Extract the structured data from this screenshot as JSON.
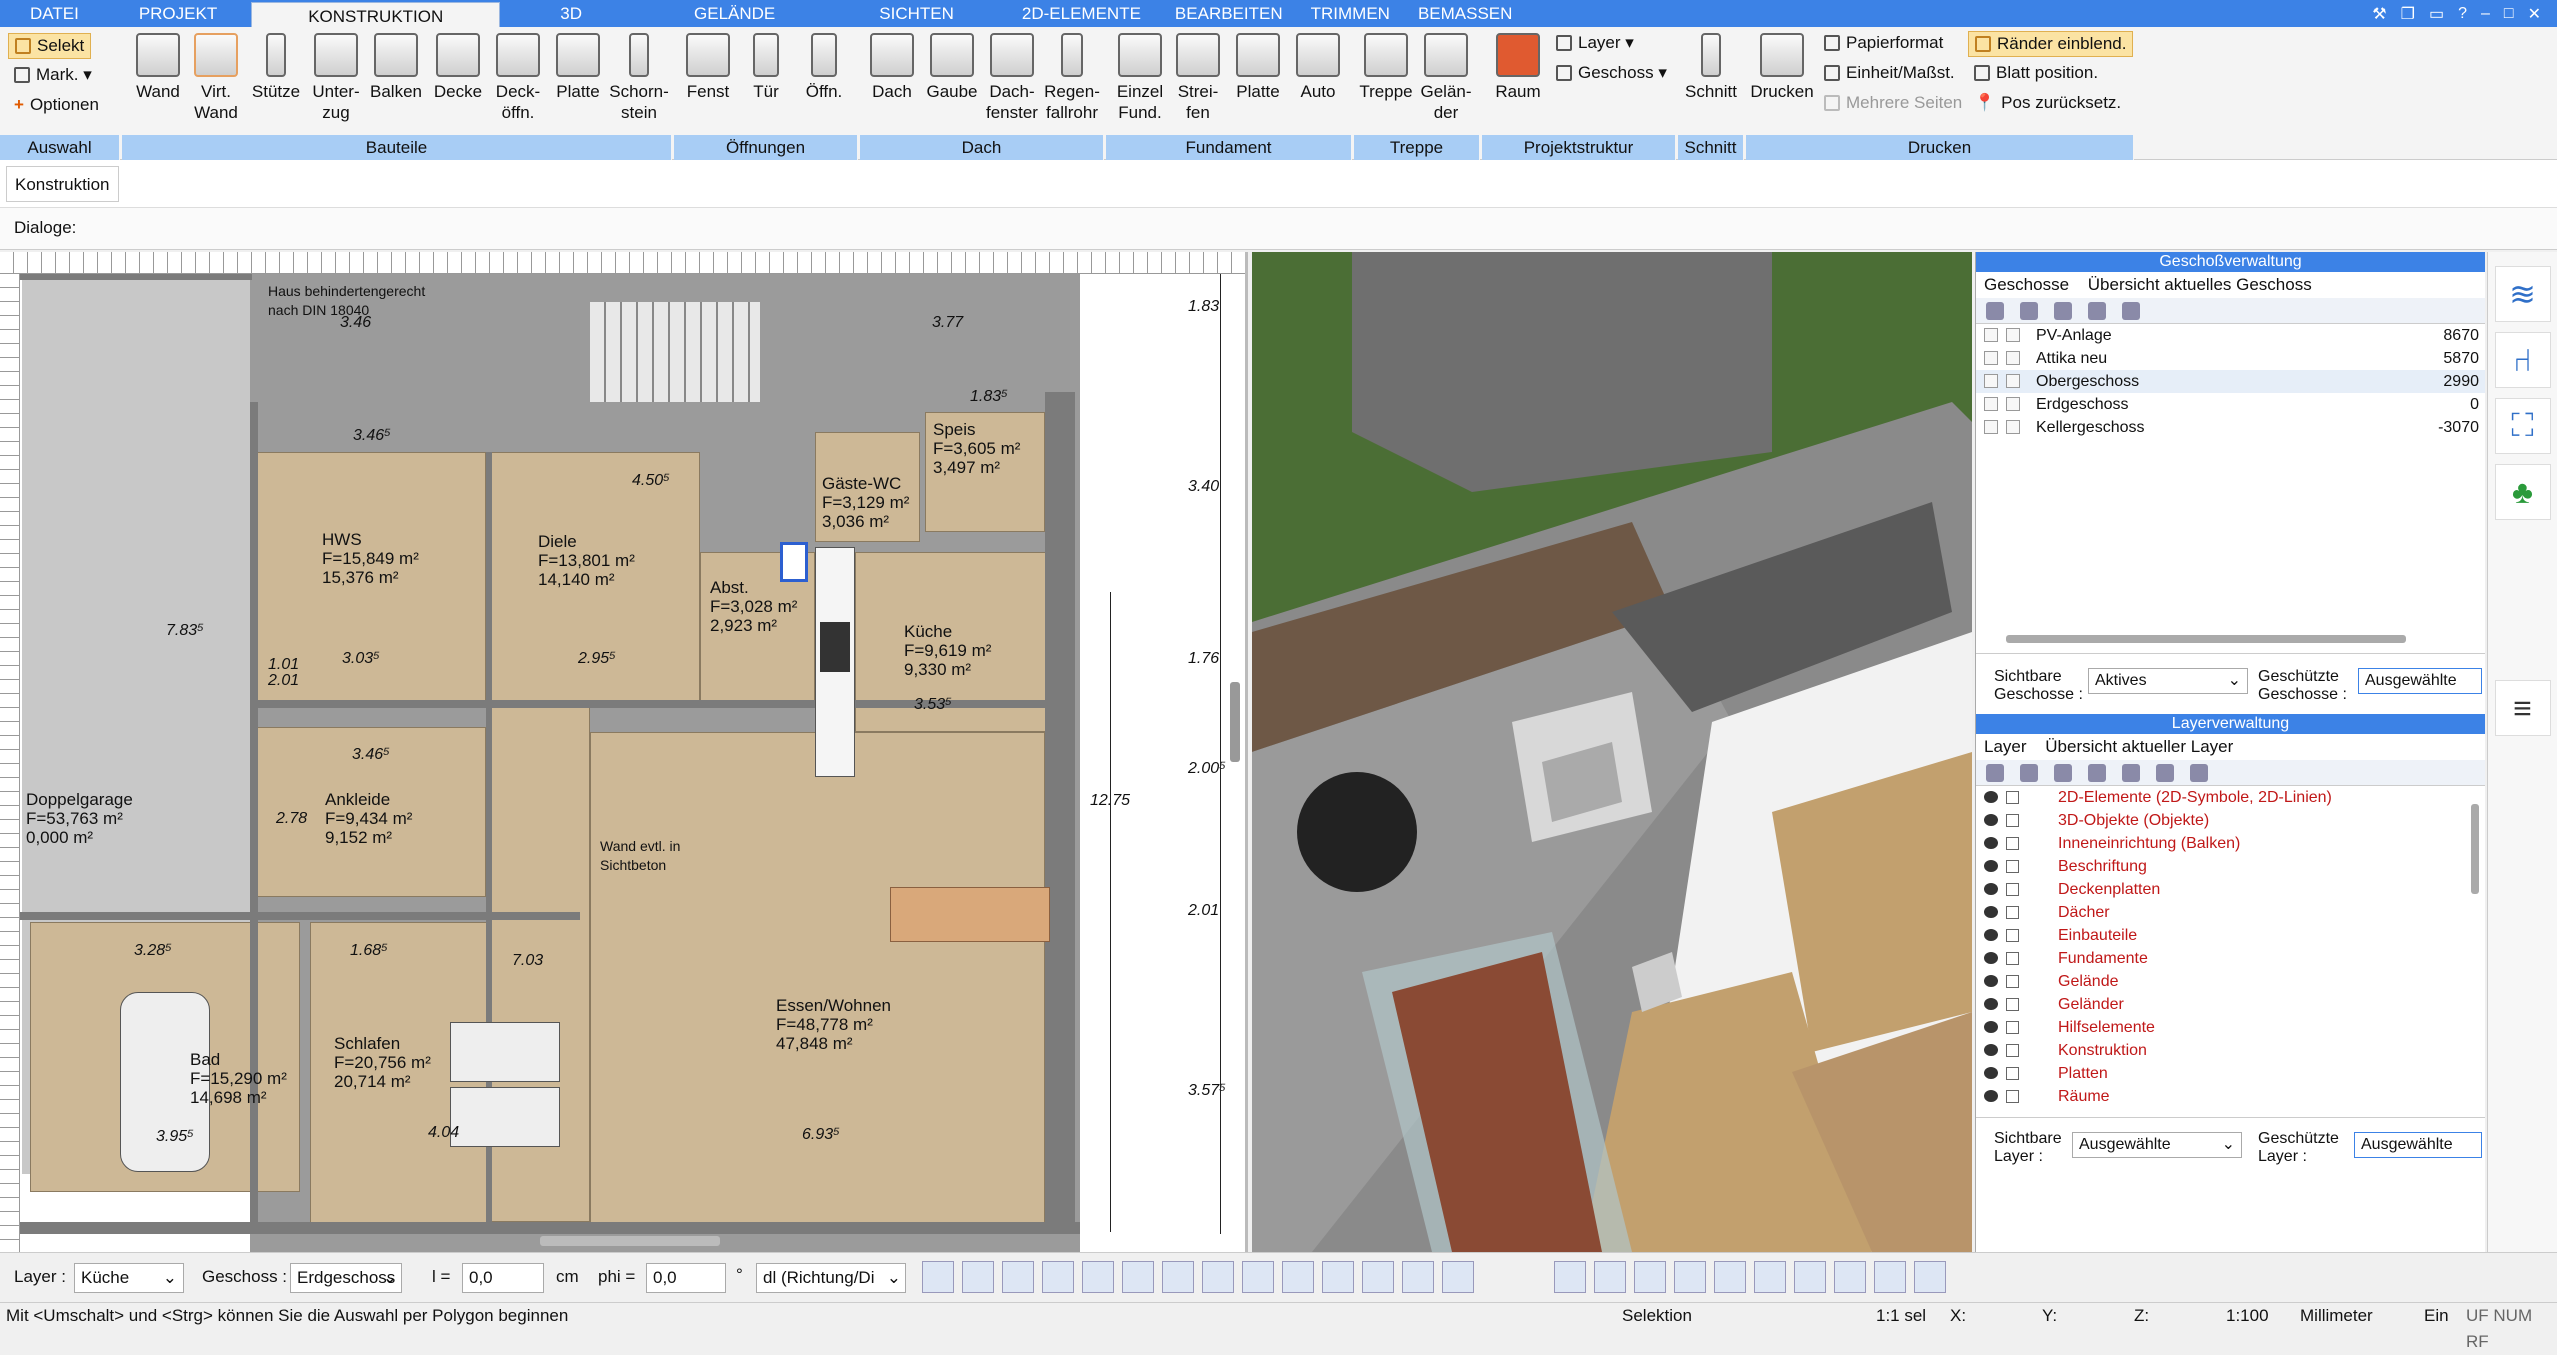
{
  "tabs": [
    "DATEI",
    "PROJEKT",
    "KONSTRUKTION",
    "3D",
    "GELÄNDE",
    "SICHTEN",
    "2D-ELEMENTE",
    "BEARBEITEN",
    "TRIMMEN",
    "BEMASSEN"
  ],
  "ribbon": {
    "auswahl": {
      "label": "Auswahl",
      "selekt": "Selekt",
      "mark": "Mark.",
      "optionen": "Optionen"
    },
    "bauteile": {
      "label": "Bauteile",
      "items": [
        "Wand",
        "Virt. Wand",
        "Stütze",
        "Unter- zug",
        "Balken",
        "Decke",
        "Deck- öffn.",
        "Platte",
        "Schorn- stein"
      ]
    },
    "oeffnungen": {
      "label": "Öffnungen",
      "items": [
        "Fenst",
        "Tür",
        "Öffn."
      ]
    },
    "dach": {
      "label": "Dach",
      "items": [
        "Dach",
        "Gaube",
        "Dach- fenster",
        "Regen- fallrohr"
      ]
    },
    "fundament": {
      "label": "Fundament",
      "items": [
        "Einzel Fund.",
        "Strei- fen",
        "Platte",
        "Auto"
      ]
    },
    "treppe": {
      "label": "Treppe",
      "items": [
        "Treppe",
        "Gelän- der"
      ]
    },
    "projektstruktur": {
      "label": "Projektstruktur",
      "layer": "Layer",
      "geschoss": "Geschoss",
      "raum": "Raum"
    },
    "schnitt": {
      "label": "Schnitt",
      "item": "Schnitt"
    },
    "drucken": {
      "label": "Drucken",
      "drucken": "Drucken",
      "papierformat": "Papierformat",
      "einheit": "Einheit/Maßst.",
      "mehrere": "Mehrere Seiten",
      "raender": "Ränder einblend.",
      "blatt": "Blatt position.",
      "pos": "Pos zurücksetz."
    }
  },
  "subtoolbar": {
    "konstruktion": "Konstruktion",
    "dialoge": "Dialoge:"
  },
  "plan": {
    "note": "Haus behindertengerecht nach DIN 18040",
    "rooms": [
      {
        "name": "HWS",
        "f": "F=15,849 m²",
        "a": "15,376 m²"
      },
      {
        "name": "Diele",
        "f": "F=13,801 m²",
        "a": "14,140 m²"
      },
      {
        "name": "Speis",
        "f": "F=3,605 m²",
        "a": "3,497 m²"
      },
      {
        "name": "Gäste-WC",
        "f": "F=3,129 m²",
        "a": "3,036 m²"
      },
      {
        "name": "Abst.",
        "f": "F=3,028 m²",
        "a": "2,923 m²"
      },
      {
        "name": "Küche",
        "f": "F=9,619 m²",
        "a": "9,330 m²"
      },
      {
        "name": "Doppelgarage",
        "f": "F=53,763 m²",
        "a": "0,000 m²"
      },
      {
        "name": "Ankleide",
        "f": "F=9,434 m²",
        "a": "9,152 m²"
      },
      {
        "name": "Essen/Wohnen",
        "f": "F=48,778 m²",
        "a": "47,848 m²"
      },
      {
        "name": "Bad",
        "f": "F=15,290 m²",
        "a": "14,698 m²"
      },
      {
        "name": "Schlafen",
        "f": "F=20,756 m²",
        "a": "20,714 m²"
      }
    ],
    "wandnote": "Wand evtl. in Sichtbeton",
    "dims": [
      "3.46",
      "3.77",
      "3.46⁵",
      "4.50⁵",
      "2.95⁵",
      "3.03⁵",
      "3.53⁵",
      "3.46⁵",
      "7.83⁵",
      "1.68⁵",
      "3.28⁵",
      "3.95⁵",
      "4.04",
      "6.93⁵",
      "7.03",
      "2.78",
      "1.83⁵",
      "1.01",
      "2.01"
    ],
    "rightdims": [
      "1.83",
      "3.40",
      "1.76",
      "2.00⁵",
      "2.01",
      "3.57⁵",
      "12.75"
    ]
  },
  "geschoss_panel": {
    "title": "Geschoßverwaltung",
    "tab1": "Geschosse",
    "tab2": "Übersicht aktuelles Geschoss",
    "rows": [
      {
        "name": "PV-Anlage",
        "val": "8670"
      },
      {
        "name": "Attika neu",
        "val": "5870"
      },
      {
        "name": "Obergeschoss",
        "val": "2990"
      },
      {
        "name": "Erdgeschoss",
        "val": "0"
      },
      {
        "name": "Kellergeschoss",
        "val": "-3070"
      }
    ],
    "sichtbare": "Sichtbare Geschosse :",
    "sichtbare_val": "Aktives",
    "geschuetzte": "Geschützte Geschosse :",
    "geschuetzte_val": "Ausgewählte"
  },
  "layer_panel": {
    "title": "Layerverwaltung",
    "tab1": "Layer",
    "tab2": "Übersicht aktueller Layer",
    "rows": [
      "2D-Elemente (2D-Symbole, 2D-Linien)",
      "3D-Objekte (Objekte)",
      "Inneneinrichtung (Balken)",
      "Beschriftung",
      "Deckenplatten",
      "Dächer",
      "Einbauteile",
      "Fundamente",
      "Gelände",
      "Geländer",
      "Hilfselemente",
      "Konstruktion",
      "Platten",
      "Räume"
    ],
    "sichtbare": "Sichtbare Layer :",
    "sichtbare_val": "Ausgewählte",
    "geschuetzte": "Geschützte Layer :",
    "geschuetzte_val": "Ausgewählte"
  },
  "bottom": {
    "layer_label": "Layer :",
    "layer_val": "Küche",
    "geschoss_label": "Geschoss :",
    "geschoss_val": "Erdgeschoss",
    "l_label": "l =",
    "l_val": "0,0",
    "cm": "cm",
    "phi_label": "phi =",
    "phi_val": "0,0",
    "deg": "°",
    "dl": "dl (Richtung/Di"
  },
  "status": {
    "hint": "Mit <Umschalt> und <Strg> können Sie die Auswahl per Polygon beginnen",
    "selektion": "Selektion",
    "sel": "1:1 sel",
    "x": "X:",
    "y": "Y:",
    "z": "Z:",
    "scale": "1:100",
    "unit": "Millimeter",
    "ein": "Ein",
    "flags": "UF NUM RF"
  },
  "colors": {
    "accent": "#3c82e6",
    "group": "#a8cdf5",
    "layer_text": "#c01818",
    "floor": "#cdb896"
  }
}
